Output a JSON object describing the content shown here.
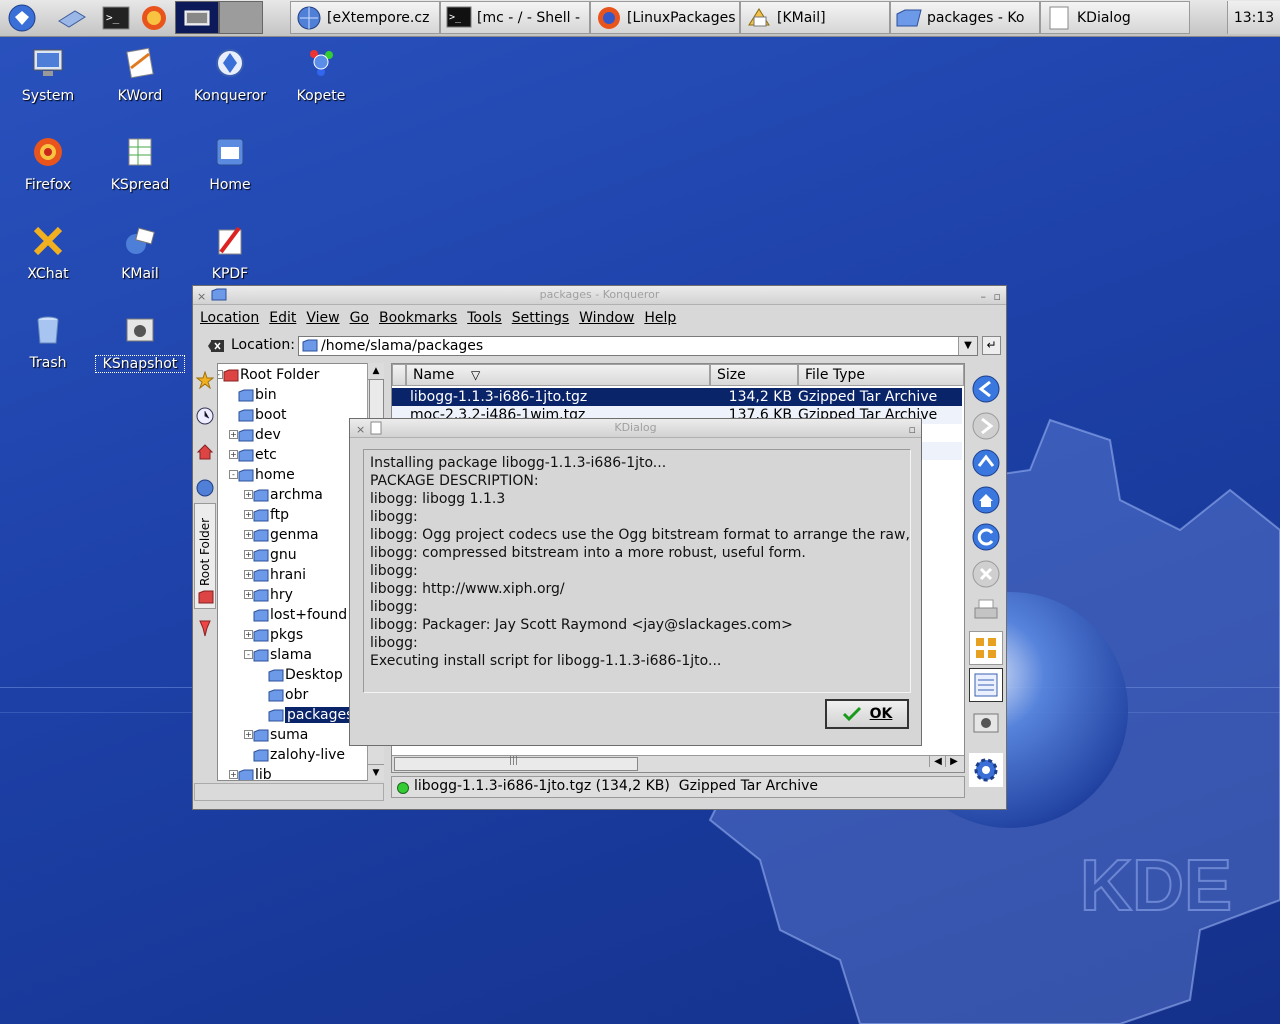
{
  "taskbar": {
    "quick_launch": [
      "kde-menu-icon",
      "show-desktop-icon",
      "terminal-icon",
      "firefox-icon",
      "desktop-pager-icon"
    ],
    "tasks": [
      {
        "label": "[eXtempore.cz",
        "icon": "konqueror-globe-icon"
      },
      {
        "label": "[mc - / - Shell -",
        "icon": "terminal-icon"
      },
      {
        "label": "[LinuxPackages",
        "icon": "firefox-icon"
      },
      {
        "label": "[KMail]",
        "icon": "kmail-icon"
      },
      {
        "label": "packages - Ko",
        "icon": "folder-icon"
      },
      {
        "label": "KDialog",
        "icon": "dialog-icon"
      }
    ],
    "clock": "13:13"
  },
  "desktop_icons": [
    {
      "label": "System",
      "icon": "monitor-icon"
    },
    {
      "label": "KWord",
      "icon": "kword-icon"
    },
    {
      "label": "Konqueror",
      "icon": "konqueror-icon"
    },
    {
      "label": "Kopete",
      "icon": "kopete-icon"
    },
    {
      "label": "Firefox",
      "icon": "firefox-icon"
    },
    {
      "label": "KSpread",
      "icon": "kspread-icon"
    },
    {
      "label": "Home",
      "icon": "home-folder-icon"
    },
    {
      "label": "XChat",
      "icon": "xchat-icon"
    },
    {
      "label": "KMail",
      "icon": "kmail-icon"
    },
    {
      "label": "KPDF",
      "icon": "kpdf-icon"
    },
    {
      "label": "Trash",
      "icon": "trash-icon"
    },
    {
      "label": "KSnapshot",
      "icon": "camera-icon"
    }
  ],
  "konqueror": {
    "title": "packages - Konqueror",
    "menus": [
      "Location",
      "Edit",
      "View",
      "Go",
      "Bookmarks",
      "Tools",
      "Settings",
      "Window",
      "Help"
    ],
    "location_label": "Location:",
    "location_value": "/home/slama/packages",
    "sidebar_tab": "Root Folder",
    "tree": [
      {
        "label": "Root Folder",
        "depth": 0,
        "exp": "-"
      },
      {
        "label": "bin",
        "depth": 1,
        "exp": ""
      },
      {
        "label": "boot",
        "depth": 1,
        "exp": ""
      },
      {
        "label": "dev",
        "depth": 1,
        "exp": "+"
      },
      {
        "label": "etc",
        "depth": 1,
        "exp": "+"
      },
      {
        "label": "home",
        "depth": 1,
        "exp": "-"
      },
      {
        "label": "archma",
        "depth": 2,
        "exp": "+"
      },
      {
        "label": "ftp",
        "depth": 2,
        "exp": "+"
      },
      {
        "label": "genma",
        "depth": 2,
        "exp": "+"
      },
      {
        "label": "gnu",
        "depth": 2,
        "exp": "+"
      },
      {
        "label": "hrani",
        "depth": 2,
        "exp": "+"
      },
      {
        "label": "hry",
        "depth": 2,
        "exp": "+"
      },
      {
        "label": "lost+found",
        "depth": 2,
        "exp": ""
      },
      {
        "label": "pkgs",
        "depth": 2,
        "exp": "+"
      },
      {
        "label": "slama",
        "depth": 2,
        "exp": "-"
      },
      {
        "label": "Desktop",
        "depth": 3,
        "exp": ""
      },
      {
        "label": "obr",
        "depth": 3,
        "exp": ""
      },
      {
        "label": "packages",
        "depth": 3,
        "exp": "",
        "selected": true
      },
      {
        "label": "suma",
        "depth": 2,
        "exp": "+"
      },
      {
        "label": "zalohy-live",
        "depth": 2,
        "exp": ""
      },
      {
        "label": "lib",
        "depth": 1,
        "exp": "+"
      }
    ],
    "columns": {
      "name": "Name",
      "size": "Size",
      "type": "File Type"
    },
    "files": [
      {
        "name": "libogg-1.1.3-i686-1jto.tgz",
        "size": "134,2 KB",
        "type": "Gzipped Tar Archive",
        "selected": true
      },
      {
        "name": "moc-2.3.2-i486-1wim.tgz",
        "size": "137,6 KB",
        "type": "Gzipped Tar Archive"
      },
      {
        "name": "",
        "size": "",
        "type": "ve"
      },
      {
        "name": "",
        "size": "",
        "type": "ve"
      }
    ],
    "status": "libogg-1.1.3-i686-1jto.tgz (134,2 KB)  Gzipped Tar Archive"
  },
  "dialog": {
    "title": "KDialog",
    "lines": [
      "Installing package libogg-1.1.3-i686-1jto...",
      "PACKAGE DESCRIPTION:",
      "libogg: libogg 1.1.3",
      "libogg:",
      "libogg: Ogg project codecs use the Ogg bitstream format to arrange the raw,",
      "libogg: compressed bitstream into a more robust, useful form.",
      "libogg:",
      "libogg: http://www.xiph.org/",
      "libogg:",
      "libogg: Packager: Jay Scott Raymond <jay@slackages.com>",
      "libogg:",
      "Executing install script for libogg-1.1.3-i686-1jto..."
    ],
    "ok_label": "OK"
  },
  "wallpaper_text": "KDE",
  "colors": {
    "accent": "#0a246a",
    "selection": "#0a246a",
    "desktop": "#1d41a8"
  }
}
